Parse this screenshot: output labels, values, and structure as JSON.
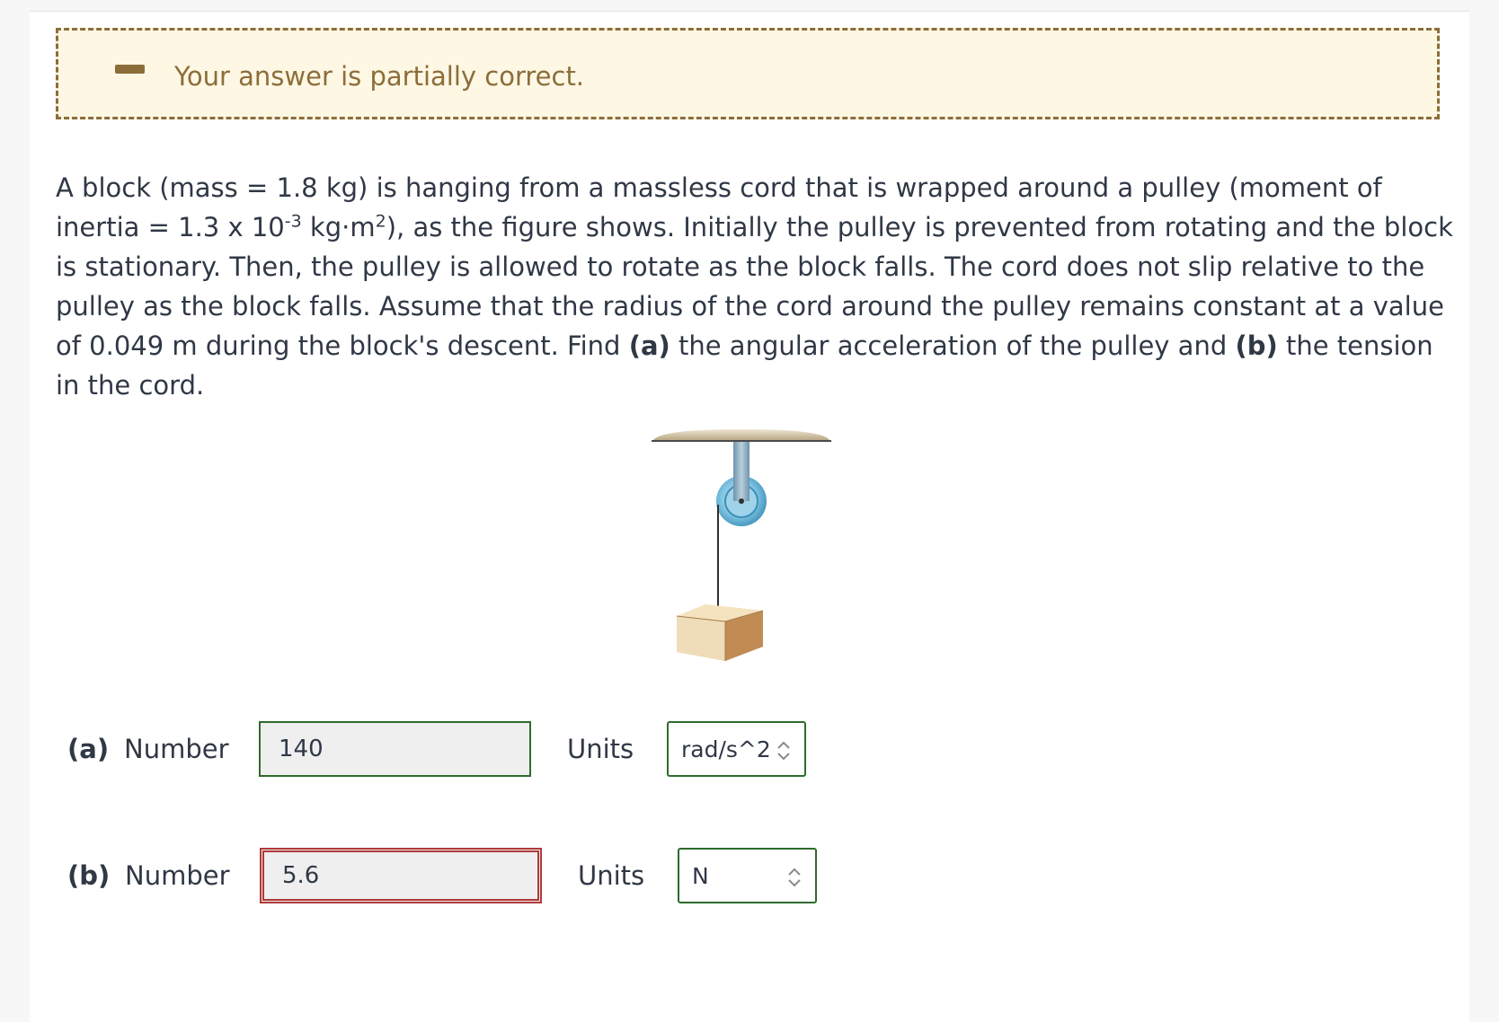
{
  "feedback": {
    "message": "Your answer is partially correct.",
    "status_color": "#8c6d3a",
    "icon": "minus-icon"
  },
  "problem": {
    "seg1": "A block (mass = 1.8 kg) is hanging from a massless cord that is wrapped around a pulley (moment of inertia = 1.3 x 10",
    "exp1": "-3",
    "seg2": " kg·m",
    "exp2": "2",
    "seg3": "), as the figure shows. Initially the pulley is prevented from rotating and the block is stationary. Then, the pulley is allowed to rotate as the block falls. The cord does not slip relative to the pulley as the block falls. Assume that the radius of the cord around the pulley remains constant at a value of 0.049 m during the block's descent. Find ",
    "bold_a": "(a)",
    "seg4": " the angular acceleration of the pulley and ",
    "bold_b": "(b)",
    "seg5": " the tension in the cord."
  },
  "answers": {
    "a": {
      "part": "(a)",
      "label": "Number",
      "value": "140",
      "units_label": "Units",
      "unit": "rad/s^2",
      "status": "correct"
    },
    "b": {
      "part": "(b)",
      "label": "Number",
      "value": "5.6",
      "units_label": "Units",
      "unit": "N",
      "status": "incorrect"
    }
  },
  "colors": {
    "correct": "#2e6b2c",
    "incorrect": "#b03a3a"
  }
}
